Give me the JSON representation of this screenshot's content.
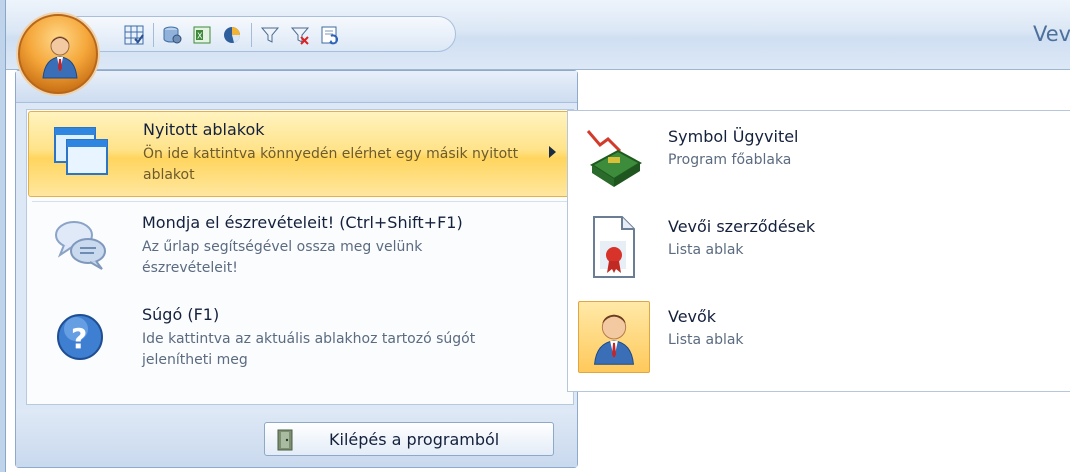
{
  "window": {
    "title_partial": "Vev"
  },
  "qat": {
    "icons": [
      "grid-icon",
      "database-icon",
      "excel-icon",
      "chart-icon",
      "filter-icon",
      "clear-filter-icon",
      "refresh-icon"
    ]
  },
  "menu": {
    "items": [
      {
        "title": "Nyitott ablakok",
        "desc": "Ön ide kattintva könnyedén elérhet egy másik nyitott ablakot",
        "icon": "windows-icon",
        "has_submenu": true,
        "highlighted": true
      },
      {
        "title": "Mondja el észrevételeit! (Ctrl+Shift+F1)",
        "desc": "Az űrlap segítségével ossza meg velünk észrevételeit!",
        "icon": "feedback-icon"
      },
      {
        "title": "Súgó (F1)",
        "desc": "Ide kattintva az aktuális ablakhoz tartozó súgót jelenítheti meg",
        "icon": "help-icon"
      }
    ],
    "exit_label": "Kilépés a programból"
  },
  "submenu": {
    "items": [
      {
        "title": "Symbol Ügyvitel",
        "desc": "Program főablaka",
        "icon": "app-main-icon"
      },
      {
        "title": "Vevői szerződések",
        "desc": "Lista ablak",
        "icon": "contract-icon"
      },
      {
        "title": "Vevők",
        "desc": "Lista ablak",
        "icon": "customer-icon",
        "active": true
      }
    ]
  },
  "colors": {
    "highlight": "#ffd55e",
    "frame": "#dde8f6",
    "accent_orange": "#f5a73a"
  }
}
